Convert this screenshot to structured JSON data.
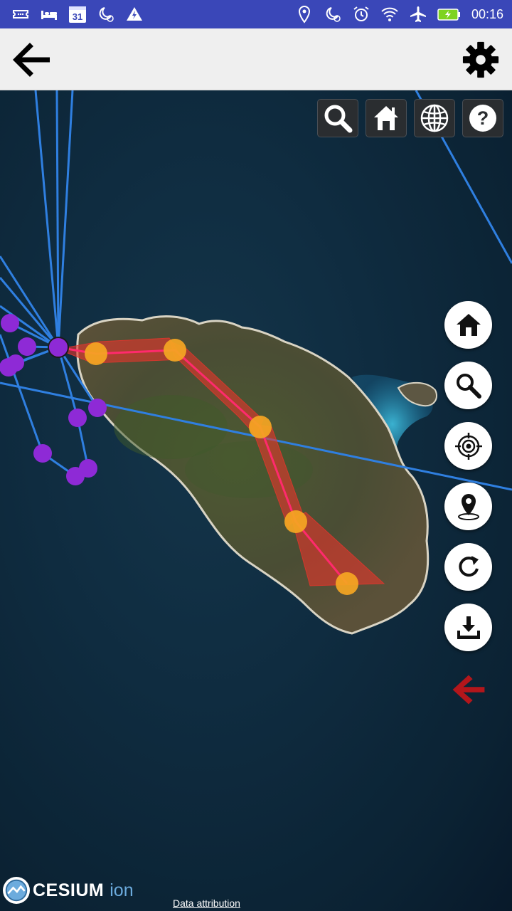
{
  "status_bar": {
    "time": "00:16",
    "calendar_day": "31",
    "left_icons": [
      "ticket-icon",
      "bed-icon",
      "calendar-icon",
      "night-clock-icon",
      "warning-icon"
    ],
    "right_icons": [
      "location-pin-icon",
      "night-clock-icon",
      "alarm-icon",
      "wifi-icon",
      "airplane-icon",
      "battery-charging-icon"
    ],
    "colors": {
      "background": "#3a47b8"
    }
  },
  "app_bar": {
    "back_icon": "arrow-left-icon",
    "settings_icon": "gear-icon"
  },
  "map_toolbar": {
    "buttons": [
      "search-icon",
      "home-icon",
      "globe-icon",
      "help-icon"
    ],
    "help_label": "?"
  },
  "fab_buttons": [
    "home-icon",
    "search-icon",
    "target-icon",
    "location-pin-icon",
    "refresh-icon",
    "download-icon"
  ],
  "collapse_icon": "arrow-left-icon",
  "footer": {
    "logo_word": "CESIUM",
    "logo_suffix": "ion",
    "attribution_link": "Data attribution"
  },
  "colors": {
    "route_red": "#e8352c",
    "waypoint_orange": "#f5a623",
    "waypoint_purple": "#8e2ad6",
    "flight_blue": "#2f7fe0",
    "accent_dark_red": "#b3161b"
  }
}
